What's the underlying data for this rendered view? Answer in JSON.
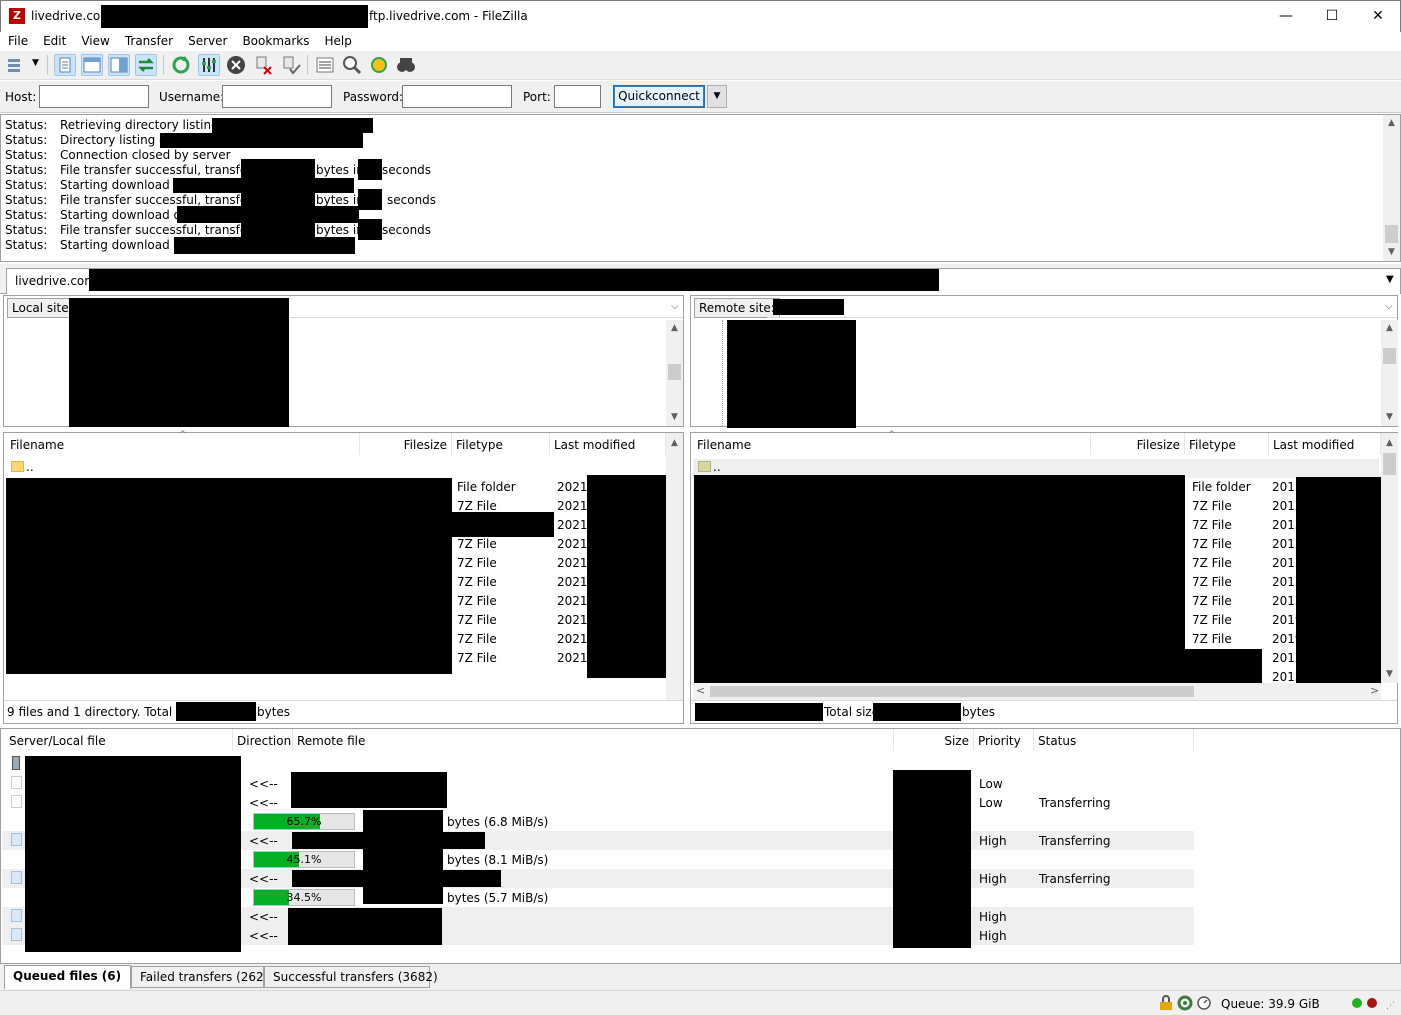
{
  "window": {
    "title_prefix": "livedrive.com",
    "title_suffix": "ftp.livedrive.com - FileZilla",
    "minimize": "—",
    "maximize": "☐",
    "close": "✕"
  },
  "menu": [
    "File",
    "Edit",
    "View",
    "Transfer",
    "Server",
    "Bookmarks",
    "Help"
  ],
  "toolbar": {
    "icons": [
      "site-manager-icon",
      "toggle-log-icon",
      "toggle-local-tree-icon",
      "toggle-remote-tree-icon",
      "toggle-queue-icon",
      "refresh-icon",
      "process-queue-icon",
      "cancel-icon",
      "disconnect-icon",
      "reconnect-icon",
      "filter-icon",
      "compare-icon",
      "sync-browse-icon",
      "search-icon"
    ]
  },
  "quickconnect": {
    "host_label": "Host:",
    "username_label": "Username:",
    "password_label": "Password:",
    "port_label": "Port:",
    "host_value": "",
    "username_value": "",
    "password_value": "",
    "port_value": "",
    "button_label": "Quickconnect",
    "dropdown": "▼"
  },
  "log": [
    {
      "status": "Status:",
      "text": "Retrieving directory listing of"
    },
    {
      "status": "Status:",
      "text": "Directory listing of"
    },
    {
      "status": "Status:",
      "text": "Connection closed by server"
    },
    {
      "status": "Status:",
      "text": "File transfer successful, transferred",
      "mid": "bytes in",
      "end": "seconds"
    },
    {
      "status": "Status:",
      "text": "Starting download of"
    },
    {
      "status": "Status:",
      "text": "File transfer successful, transferred",
      "mid": "bytes in",
      "end": "seconds"
    },
    {
      "status": "Status:",
      "text": "Starting download of /"
    },
    {
      "status": "Status:",
      "text": "File transfer successful, transferred",
      "mid": "bytes in",
      "end": "seconds"
    },
    {
      "status": "Status:",
      "text": "Starting download of"
    }
  ],
  "tab": {
    "label": "livedrive.com"
  },
  "local": {
    "site_label": "Local site:",
    "columns": [
      "Filename",
      "Filesize",
      "Filetype",
      "Last modified"
    ],
    "parent": "..",
    "rows": [
      {
        "type": "File folder",
        "modified": "2021-"
      },
      {
        "type": "7Z File",
        "modified": "2021-"
      },
      {
        "type": "",
        "modified": "2021-"
      },
      {
        "type": "7Z File",
        "modified": "2021-"
      },
      {
        "type": "7Z File",
        "modified": "2021-"
      },
      {
        "type": "7Z File",
        "modified": "2021-"
      },
      {
        "type": "7Z File",
        "modified": "2021-"
      },
      {
        "type": "7Z File",
        "modified": "2021-"
      },
      {
        "type": "7Z File",
        "modified": "2021-"
      },
      {
        "type": "7Z File",
        "modified": "2021-"
      }
    ],
    "status_prefix": "9 files and 1 directory. Total size:",
    "status_suffix": "bytes"
  },
  "remote": {
    "site_label": "Remote site:",
    "columns": [
      "Filename",
      "Filesize",
      "Filetype",
      "Last modified"
    ],
    "parent": "..",
    "rows": [
      {
        "type": "File folder",
        "modified": "2013"
      },
      {
        "type": "7Z File",
        "modified": "2015"
      },
      {
        "type": "7Z File",
        "modified": "2015"
      },
      {
        "type": "7Z File",
        "modified": "2015"
      },
      {
        "type": "7Z File",
        "modified": "2015"
      },
      {
        "type": "7Z File",
        "modified": "2015"
      },
      {
        "type": "7Z File",
        "modified": "2015"
      },
      {
        "type": "7Z File",
        "modified": "2019"
      },
      {
        "type": "7Z File",
        "modified": "2019"
      },
      {
        "type": "",
        "modified": "2015"
      },
      {
        "type": "",
        "modified": "2013"
      }
    ],
    "status_mid": "Total size",
    "status_suffix": "bytes"
  },
  "queue": {
    "columns": [
      "Server/Local file",
      "Direction",
      "Remote file",
      "Size",
      "Priority",
      "Status"
    ],
    "rows": [
      {
        "direction": "",
        "priority": "",
        "status": "",
        "kind": "server"
      },
      {
        "direction": "<<--",
        "priority": "Low",
        "status": "",
        "kind": "file"
      },
      {
        "direction": "<<--",
        "priority": "Low",
        "status": "Transferring",
        "kind": "file"
      },
      {
        "direction": "",
        "priority": "",
        "status": "",
        "kind": "progress",
        "percent": 65.7,
        "percent_label": "65.7%",
        "rate": "bytes (6.8 MiB/s)"
      },
      {
        "direction": "<<--",
        "priority": "High",
        "status": "Transferring",
        "kind": "file"
      },
      {
        "direction": "",
        "priority": "",
        "status": "",
        "kind": "progress",
        "percent": 45.1,
        "percent_label": "45.1%",
        "rate": "bytes (8.1 MiB/s)"
      },
      {
        "direction": "<<--",
        "priority": "High",
        "status": "Transferring",
        "kind": "file"
      },
      {
        "direction": "",
        "priority": "",
        "status": "",
        "kind": "progress",
        "percent": 34.5,
        "percent_label": "34.5%",
        "rate": "bytes (5.7 MiB/s)"
      },
      {
        "direction": "<<--",
        "priority": "High",
        "status": "",
        "kind": "file"
      },
      {
        "direction": "<<--",
        "priority": "High",
        "status": "",
        "kind": "file"
      }
    ]
  },
  "bottom_tabs": [
    "Queued files (6)",
    "Failed transfers (262)",
    "Successful transfers (3682)"
  ],
  "statusbar": {
    "queue": "Queue: 39.9 GiB"
  }
}
